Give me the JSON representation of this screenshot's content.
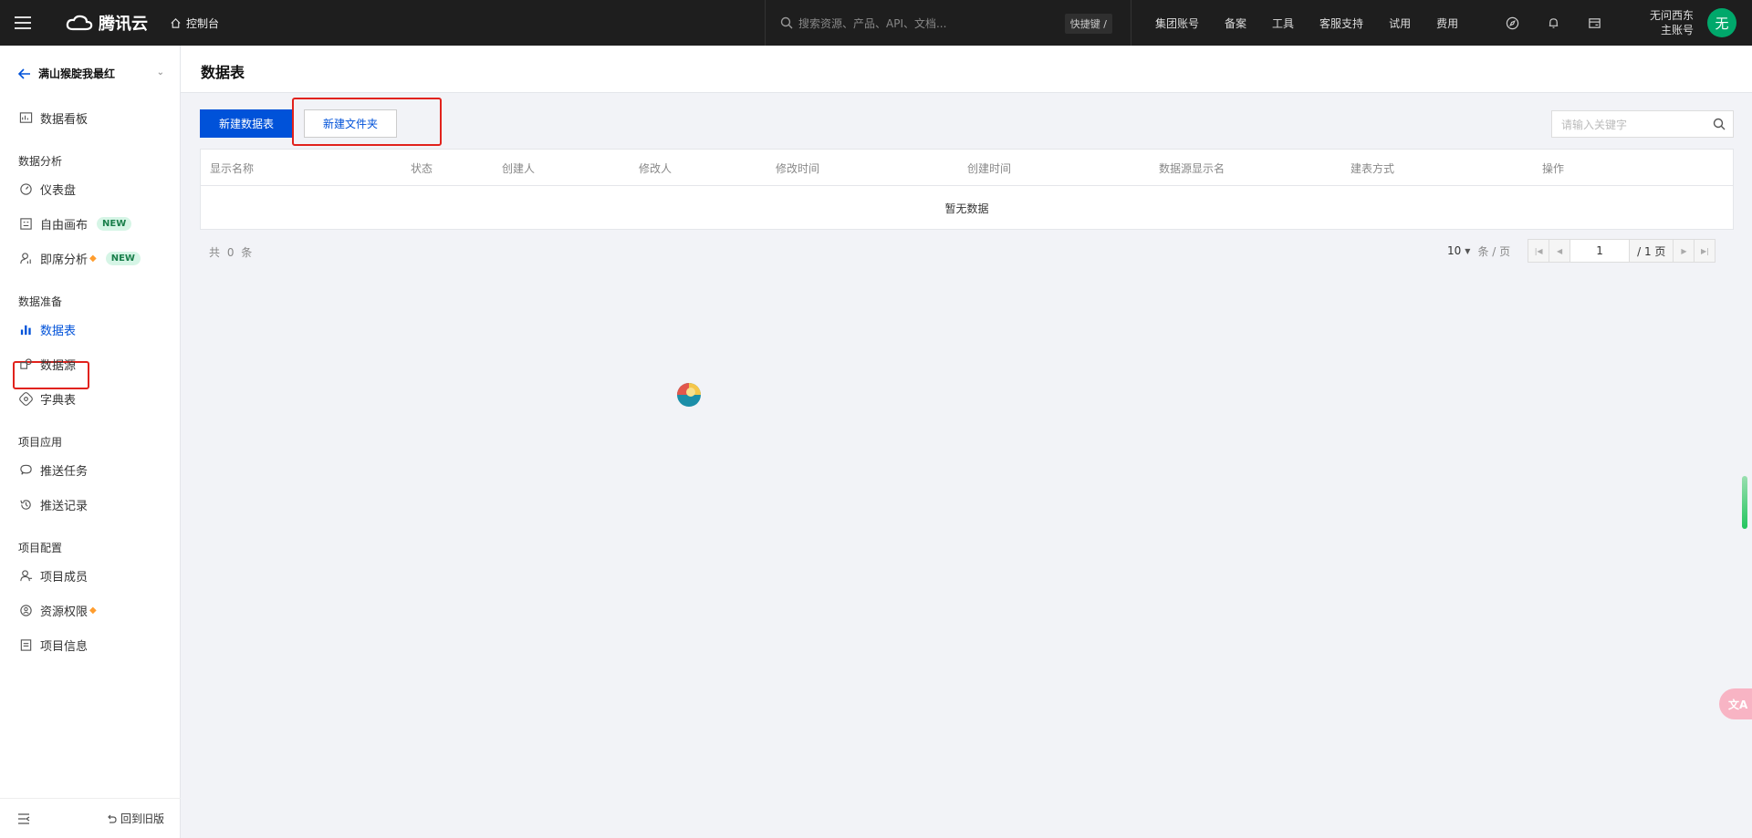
{
  "topbar": {
    "logo_text": "腾讯云",
    "console_label": "控制台",
    "search_placeholder": "搜索资源、产品、API、文档...",
    "shortcut_label": "快捷键 /",
    "nav": [
      "集团账号",
      "备案",
      "工具",
      "客服支持",
      "试用",
      "费用"
    ],
    "account_name": "无问西东",
    "account_type": "主账号",
    "avatar_char": "无"
  },
  "sidebar": {
    "project_name": "满山猴腚我最红",
    "items": [
      {
        "label": "数据看板",
        "icon": "dashboard-icon"
      },
      {
        "label": "仪表盘",
        "icon": "gauge-icon"
      },
      {
        "label": "自由画布",
        "icon": "canvas-icon",
        "badge": "NEW"
      },
      {
        "label": "即席分析",
        "icon": "analysis-icon",
        "badge": "NEW",
        "premium": true
      },
      {
        "label": "数据表",
        "icon": "bar-chart-icon",
        "active": true
      },
      {
        "label": "数据源",
        "icon": "datasource-icon"
      },
      {
        "label": "字典表",
        "icon": "dictionary-icon"
      },
      {
        "label": "推送任务",
        "icon": "chat-icon"
      },
      {
        "label": "推送记录",
        "icon": "history-icon"
      },
      {
        "label": "项目成员",
        "icon": "member-icon"
      },
      {
        "label": "资源权限",
        "icon": "permission-icon",
        "premium": true
      },
      {
        "label": "项目信息",
        "icon": "info-icon"
      }
    ],
    "groups": [
      "数据分析",
      "数据准备",
      "项目应用",
      "项目配置"
    ],
    "back_to_old": "回到旧版"
  },
  "main": {
    "title": "数据表",
    "new_table_button": "新建数据表",
    "new_folder_button": "新建文件夹",
    "search_placeholder": "请输入关键字",
    "table": {
      "columns": [
        "显示名称",
        "状态",
        "创建人",
        "修改人",
        "修改时间",
        "创建时间",
        "数据源显示名",
        "建表方式",
        "操作"
      ],
      "empty_text": "暂无数据"
    },
    "total_text": "共 0 条",
    "pagination": {
      "page_size": "10",
      "per_page_label": "条 / 页",
      "current_page": "1",
      "total_pages": "/ 1 页"
    }
  },
  "colors": {
    "primary": "#0052d9",
    "highlight": "#e1221c",
    "topbar_bg": "#1e1e1e"
  }
}
